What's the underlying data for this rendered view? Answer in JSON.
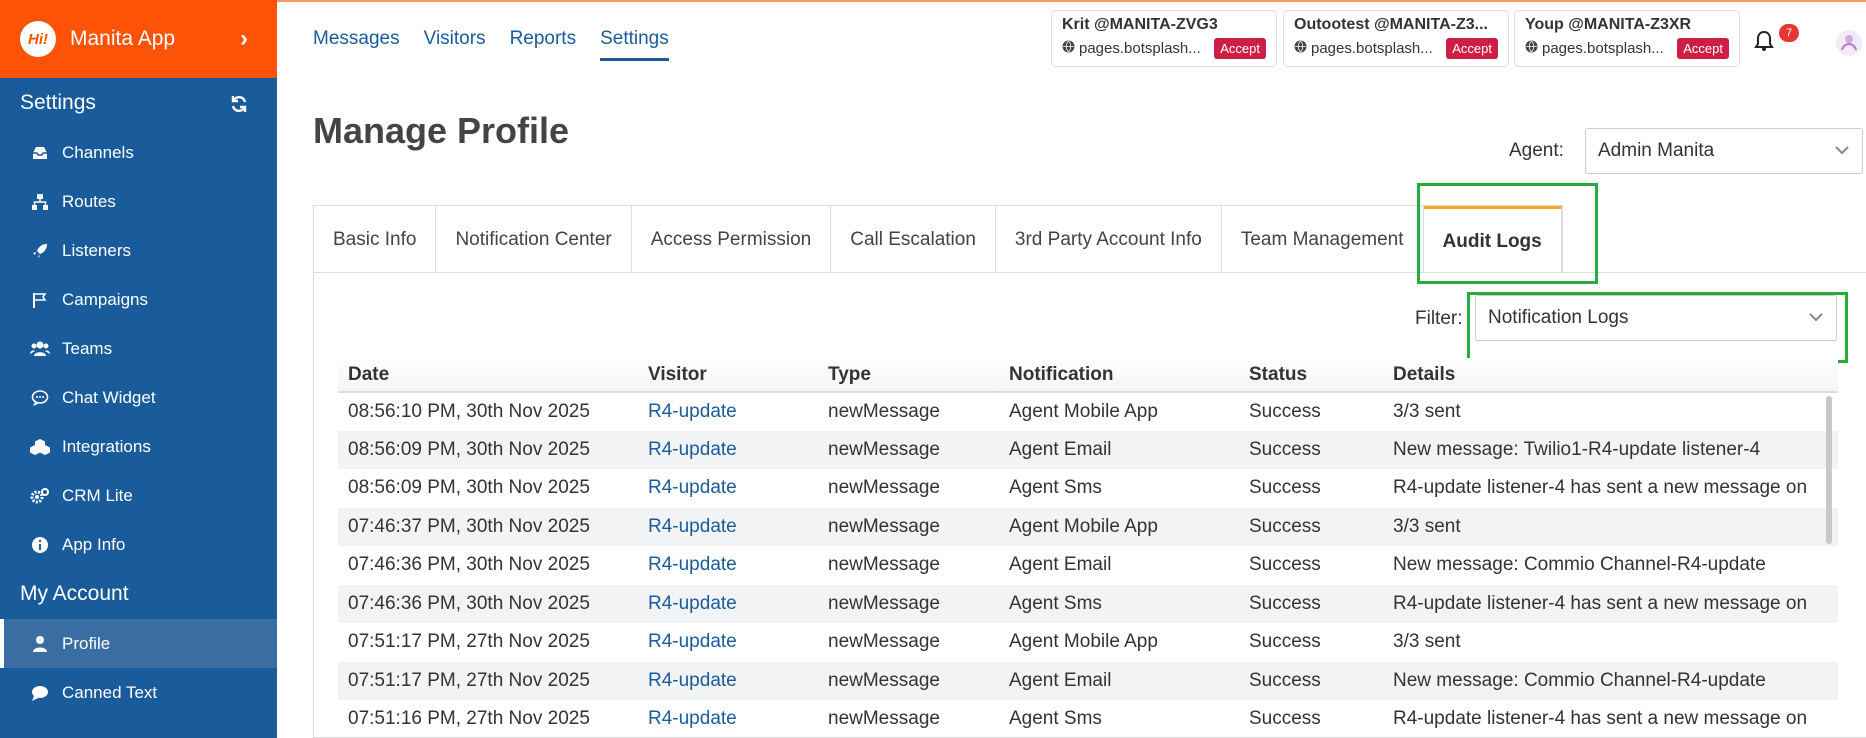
{
  "brand": {
    "name": "Manita App",
    "logo_text": "Hi!"
  },
  "sidebar": {
    "settings_title": "Settings",
    "settings_items": [
      {
        "label": "Channels",
        "icon": "inbox-icon"
      },
      {
        "label": "Routes",
        "icon": "sitemap-icon"
      },
      {
        "label": "Listeners",
        "icon": "rocket-icon"
      },
      {
        "label": "Campaigns",
        "icon": "flag-icon"
      },
      {
        "label": "Teams",
        "icon": "users-icon"
      },
      {
        "label": "Chat Widget",
        "icon": "chat-bubble-icon"
      },
      {
        "label": "Integrations",
        "icon": "cubes-icon"
      },
      {
        "label": "CRM Lite",
        "icon": "gears-icon"
      },
      {
        "label": "App Info",
        "icon": "info-icon"
      }
    ],
    "account_title": "My Account",
    "account_items": [
      {
        "label": "Profile",
        "icon": "user-icon",
        "active": true
      },
      {
        "label": "Canned Text",
        "icon": "comment-icon"
      }
    ]
  },
  "topnav": [
    "Messages",
    "Visitors",
    "Reports",
    "Settings"
  ],
  "topnav_active": "Settings",
  "chat_requests": [
    {
      "who": "Krit @MANITA-ZVG3",
      "url": "pages.botsplash...",
      "action": "Accept"
    },
    {
      "who": "Outootest @MANITA-Z3...",
      "url": "pages.botsplash...",
      "action": "Accept"
    },
    {
      "who": "Youp @MANITA-Z3XR",
      "url": "pages.botsplash...",
      "action": "Accept"
    }
  ],
  "notifications_count": "7",
  "page": {
    "title": "Manage Profile",
    "agent_label": "Agent:",
    "agent_value": "Admin Manita"
  },
  "tabs": [
    "Basic Info",
    "Notification Center",
    "Access Permission",
    "Call Escalation",
    "3rd Party Account Info",
    "Team Management",
    "Audit Logs"
  ],
  "active_tab": "Audit Logs",
  "filter": {
    "label": "Filter:",
    "value": "Notification Logs"
  },
  "table": {
    "columns": [
      "Date",
      "Visitor",
      "Type",
      "Notification",
      "Status",
      "Details"
    ],
    "rows": [
      [
        "08:56:10 PM, 30th Nov 2025",
        "R4-update",
        "newMessage",
        "Agent Mobile App",
        "Success",
        "3/3 sent"
      ],
      [
        "08:56:09 PM, 30th Nov 2025",
        "R4-update",
        "newMessage",
        "Agent Email",
        "Success",
        "New message: Twilio1-R4-update listener-4"
      ],
      [
        "08:56:09 PM, 30th Nov 2025",
        "R4-update",
        "newMessage",
        "Agent Sms",
        "Success",
        "R4-update listener-4 has sent a new message on"
      ],
      [
        "07:46:37 PM, 30th Nov 2025",
        "R4-update",
        "newMessage",
        "Agent Mobile App",
        "Success",
        "3/3 sent"
      ],
      [
        "07:46:36 PM, 30th Nov 2025",
        "R4-update",
        "newMessage",
        "Agent Email",
        "Success",
        "New message: Commio Channel-R4-update"
      ],
      [
        "07:46:36 PM, 30th Nov 2025",
        "R4-update",
        "newMessage",
        "Agent Sms",
        "Success",
        "R4-update listener-4 has sent a new message on"
      ],
      [
        "07:51:17 PM, 27th Nov 2025",
        "R4-update",
        "newMessage",
        "Agent Mobile App",
        "Success",
        "3/3 sent"
      ],
      [
        "07:51:17 PM, 27th Nov 2025",
        "R4-update",
        "newMessage",
        "Agent Email",
        "Success",
        "New message: Commio Channel-R4-update"
      ],
      [
        "07:51:16 PM, 27th Nov 2025",
        "R4-update",
        "newMessage",
        "Agent Sms",
        "Success",
        "R4-update listener-4 has sent a new message on"
      ]
    ]
  },
  "colors": {
    "sidebar": "#1a5b9b",
    "brand": "#fe5306",
    "accept": "#cd1f44",
    "highlight": "#22ad3d",
    "active_tab_accent": "#f5a623"
  }
}
